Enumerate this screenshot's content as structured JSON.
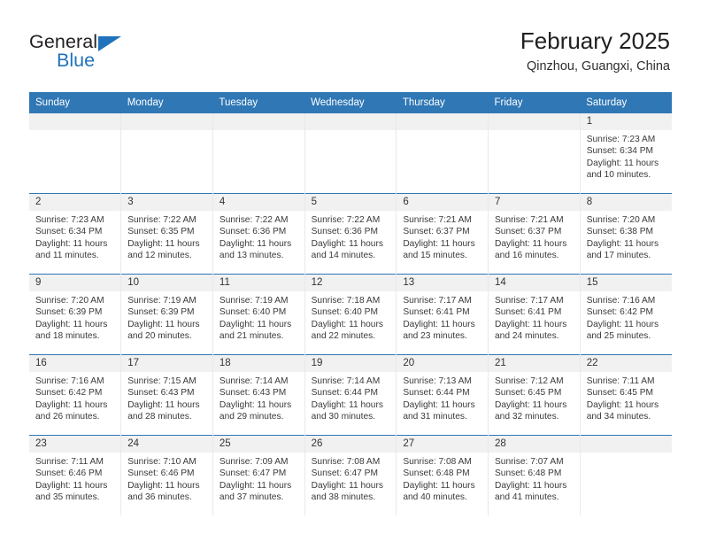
{
  "brand": {
    "name_part1": "General",
    "name_part2": "Blue",
    "accent_color": "#1f72bb"
  },
  "header": {
    "title": "February 2025",
    "subtitle": "Qinzhou, Guangxi, China",
    "header_bg_color": "#2f77b5"
  },
  "weekday_headers": [
    "Sunday",
    "Monday",
    "Tuesday",
    "Wednesday",
    "Thursday",
    "Friday",
    "Saturday"
  ],
  "weeks": [
    [
      {
        "day": "",
        "sunrise": "",
        "sunset": "",
        "daylight": ""
      },
      {
        "day": "",
        "sunrise": "",
        "sunset": "",
        "daylight": ""
      },
      {
        "day": "",
        "sunrise": "",
        "sunset": "",
        "daylight": ""
      },
      {
        "day": "",
        "sunrise": "",
        "sunset": "",
        "daylight": ""
      },
      {
        "day": "",
        "sunrise": "",
        "sunset": "",
        "daylight": ""
      },
      {
        "day": "",
        "sunrise": "",
        "sunset": "",
        "daylight": ""
      },
      {
        "day": "1",
        "sunrise": "Sunrise: 7:23 AM",
        "sunset": "Sunset: 6:34 PM",
        "daylight": "Daylight: 11 hours and 10 minutes."
      }
    ],
    [
      {
        "day": "2",
        "sunrise": "Sunrise: 7:23 AM",
        "sunset": "Sunset: 6:34 PM",
        "daylight": "Daylight: 11 hours and 11 minutes."
      },
      {
        "day": "3",
        "sunrise": "Sunrise: 7:22 AM",
        "sunset": "Sunset: 6:35 PM",
        "daylight": "Daylight: 11 hours and 12 minutes."
      },
      {
        "day": "4",
        "sunrise": "Sunrise: 7:22 AM",
        "sunset": "Sunset: 6:36 PM",
        "daylight": "Daylight: 11 hours and 13 minutes."
      },
      {
        "day": "5",
        "sunrise": "Sunrise: 7:22 AM",
        "sunset": "Sunset: 6:36 PM",
        "daylight": "Daylight: 11 hours and 14 minutes."
      },
      {
        "day": "6",
        "sunrise": "Sunrise: 7:21 AM",
        "sunset": "Sunset: 6:37 PM",
        "daylight": "Daylight: 11 hours and 15 minutes."
      },
      {
        "day": "7",
        "sunrise": "Sunrise: 7:21 AM",
        "sunset": "Sunset: 6:37 PM",
        "daylight": "Daylight: 11 hours and 16 minutes."
      },
      {
        "day": "8",
        "sunrise": "Sunrise: 7:20 AM",
        "sunset": "Sunset: 6:38 PM",
        "daylight": "Daylight: 11 hours and 17 minutes."
      }
    ],
    [
      {
        "day": "9",
        "sunrise": "Sunrise: 7:20 AM",
        "sunset": "Sunset: 6:39 PM",
        "daylight": "Daylight: 11 hours and 18 minutes."
      },
      {
        "day": "10",
        "sunrise": "Sunrise: 7:19 AM",
        "sunset": "Sunset: 6:39 PM",
        "daylight": "Daylight: 11 hours and 20 minutes."
      },
      {
        "day": "11",
        "sunrise": "Sunrise: 7:19 AM",
        "sunset": "Sunset: 6:40 PM",
        "daylight": "Daylight: 11 hours and 21 minutes."
      },
      {
        "day": "12",
        "sunrise": "Sunrise: 7:18 AM",
        "sunset": "Sunset: 6:40 PM",
        "daylight": "Daylight: 11 hours and 22 minutes."
      },
      {
        "day": "13",
        "sunrise": "Sunrise: 7:17 AM",
        "sunset": "Sunset: 6:41 PM",
        "daylight": "Daylight: 11 hours and 23 minutes."
      },
      {
        "day": "14",
        "sunrise": "Sunrise: 7:17 AM",
        "sunset": "Sunset: 6:41 PM",
        "daylight": "Daylight: 11 hours and 24 minutes."
      },
      {
        "day": "15",
        "sunrise": "Sunrise: 7:16 AM",
        "sunset": "Sunset: 6:42 PM",
        "daylight": "Daylight: 11 hours and 25 minutes."
      }
    ],
    [
      {
        "day": "16",
        "sunrise": "Sunrise: 7:16 AM",
        "sunset": "Sunset: 6:42 PM",
        "daylight": "Daylight: 11 hours and 26 minutes."
      },
      {
        "day": "17",
        "sunrise": "Sunrise: 7:15 AM",
        "sunset": "Sunset: 6:43 PM",
        "daylight": "Daylight: 11 hours and 28 minutes."
      },
      {
        "day": "18",
        "sunrise": "Sunrise: 7:14 AM",
        "sunset": "Sunset: 6:43 PM",
        "daylight": "Daylight: 11 hours and 29 minutes."
      },
      {
        "day": "19",
        "sunrise": "Sunrise: 7:14 AM",
        "sunset": "Sunset: 6:44 PM",
        "daylight": "Daylight: 11 hours and 30 minutes."
      },
      {
        "day": "20",
        "sunrise": "Sunrise: 7:13 AM",
        "sunset": "Sunset: 6:44 PM",
        "daylight": "Daylight: 11 hours and 31 minutes."
      },
      {
        "day": "21",
        "sunrise": "Sunrise: 7:12 AM",
        "sunset": "Sunset: 6:45 PM",
        "daylight": "Daylight: 11 hours and 32 minutes."
      },
      {
        "day": "22",
        "sunrise": "Sunrise: 7:11 AM",
        "sunset": "Sunset: 6:45 PM",
        "daylight": "Daylight: 11 hours and 34 minutes."
      }
    ],
    [
      {
        "day": "23",
        "sunrise": "Sunrise: 7:11 AM",
        "sunset": "Sunset: 6:46 PM",
        "daylight": "Daylight: 11 hours and 35 minutes."
      },
      {
        "day": "24",
        "sunrise": "Sunrise: 7:10 AM",
        "sunset": "Sunset: 6:46 PM",
        "daylight": "Daylight: 11 hours and 36 minutes."
      },
      {
        "day": "25",
        "sunrise": "Sunrise: 7:09 AM",
        "sunset": "Sunset: 6:47 PM",
        "daylight": "Daylight: 11 hours and 37 minutes."
      },
      {
        "day": "26",
        "sunrise": "Sunrise: 7:08 AM",
        "sunset": "Sunset: 6:47 PM",
        "daylight": "Daylight: 11 hours and 38 minutes."
      },
      {
        "day": "27",
        "sunrise": "Sunrise: 7:08 AM",
        "sunset": "Sunset: 6:48 PM",
        "daylight": "Daylight: 11 hours and 40 minutes."
      },
      {
        "day": "28",
        "sunrise": "Sunrise: 7:07 AM",
        "sunset": "Sunset: 6:48 PM",
        "daylight": "Daylight: 11 hours and 41 minutes."
      },
      {
        "day": "",
        "sunrise": "",
        "sunset": "",
        "daylight": ""
      }
    ]
  ]
}
